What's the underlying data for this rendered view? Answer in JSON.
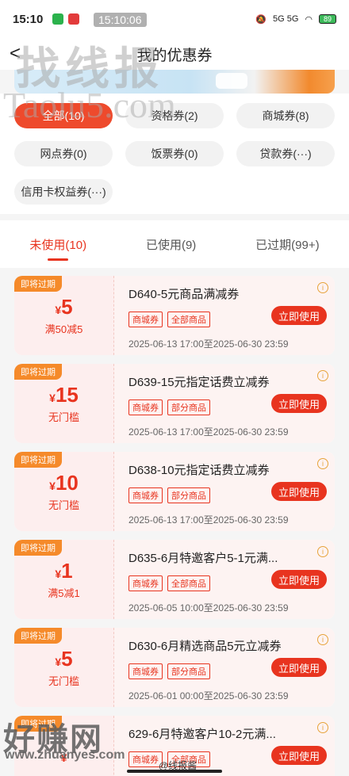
{
  "status": {
    "time": "15:10",
    "overlay_time": "15:10:06",
    "network": "5G 5G",
    "battery": "89"
  },
  "header": {
    "title": "我的优惠券",
    "back": "<"
  },
  "filters": [
    {
      "label": "全部(10)"
    },
    {
      "label": "资格券(2)"
    },
    {
      "label": "商城券(8)"
    },
    {
      "label": "网点券(0)"
    },
    {
      "label": "饭票券(0)"
    },
    {
      "label": "贷款券(···)"
    },
    {
      "label": "信用卡权益券(···)"
    }
  ],
  "tabs": [
    {
      "label": "未使用(10)"
    },
    {
      "label": "已使用(9)"
    },
    {
      "label": "已过期(99+)"
    }
  ],
  "cards": [
    {
      "tag": "即将过期",
      "currency": "¥",
      "amount": "5",
      "cond": "满50减5",
      "title": "D640-5元商品满减券",
      "tag1": "商城券",
      "tag2": "全部商品",
      "button": "立即使用",
      "validity": "2025-06-13 17:00至2025-06-30 23:59"
    },
    {
      "tag": "即将过期",
      "currency": "¥",
      "amount": "15",
      "cond": "无门槛",
      "title": "D639-15元指定话费立减券",
      "tag1": "商城券",
      "tag2": "部分商品",
      "button": "立即使用",
      "validity": "2025-06-13 17:00至2025-06-30 23:59"
    },
    {
      "tag": "即将过期",
      "currency": "¥",
      "amount": "10",
      "cond": "无门槛",
      "title": "D638-10元指定话费立减券",
      "tag1": "商城券",
      "tag2": "部分商品",
      "button": "立即使用",
      "validity": "2025-06-13 17:00至2025-06-30 23:59"
    },
    {
      "tag": "即将过期",
      "currency": "¥",
      "amount": "1",
      "cond": "满5减1",
      "title": "D635-6月特邀客户5-1元满...",
      "tag1": "商城券",
      "tag2": "全部商品",
      "button": "立即使用",
      "validity": "2025-06-05 10:00至2025-06-30 23:59"
    },
    {
      "tag": "即将过期",
      "currency": "¥",
      "amount": "5",
      "cond": "无门槛",
      "title": "D630-6月精选商品5元立减券",
      "tag1": "商城券",
      "tag2": "部分商品",
      "button": "立即使用",
      "validity": "2025-06-01 00:00至2025-06-30 23:59"
    },
    {
      "tag": "即将过期",
      "currency": "¥",
      "amount": "",
      "cond": "",
      "title": "629-6月特邀客户10-2元满...",
      "tag1": "商城券",
      "tag2": "全部商品",
      "button": "立即使用",
      "validity": ""
    }
  ],
  "watermarks": {
    "top": "找线报",
    "top_url": "Taolu5.com",
    "bottom": "好赚网",
    "bottom_url": "www.zhuanyes.com",
    "weibo": "@线报酱"
  }
}
